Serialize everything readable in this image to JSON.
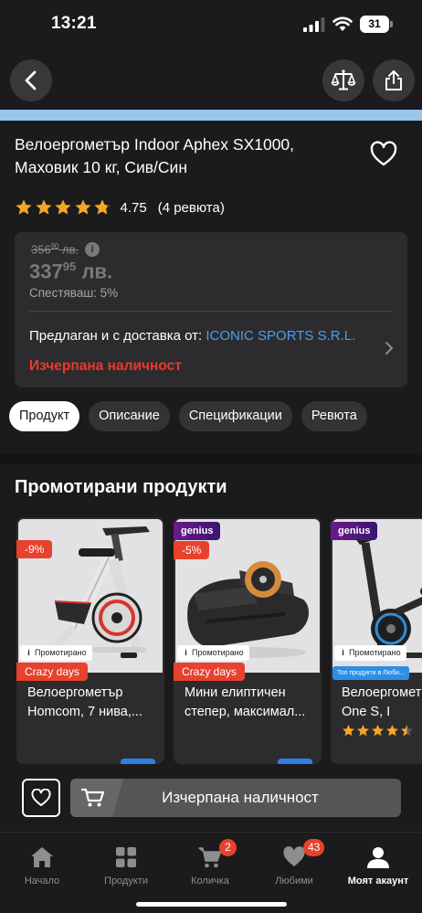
{
  "status_bar": {
    "time": "13:21",
    "battery": "31"
  },
  "product": {
    "title": "Велоергометър Indoor Aphex SX1000, Маховик 10 кг, Сив/Син",
    "rating": "4.75",
    "reviews": "(4 ревюта)",
    "stars_filled": 4.75
  },
  "price": {
    "old_main": "356",
    "old_cents": "90",
    "old_currency": " лв.",
    "current_main": "337",
    "current_cents": "95",
    "current_currency": " лв.",
    "savings": "Спестяваш: 5%",
    "info_icon": "i"
  },
  "seller": {
    "prefix": "Предлаган и с доставка от: ",
    "name": "ICONIC SPORTS S.R.L.",
    "stock_status": "Изчерпана наличност"
  },
  "tabs": [
    {
      "label": "Продукт"
    },
    {
      "label": "Описание"
    },
    {
      "label": "Спецификации"
    },
    {
      "label": "Ревюта"
    }
  ],
  "promoted": {
    "title": "Промотирани продукти",
    "items": [
      {
        "discount": "-9%",
        "promo_badge": "Промотирано",
        "promo_i": "i",
        "tag": "Crazy days",
        "name": "Велоергометър Homcom, 7 нива,..."
      },
      {
        "genius": "genius",
        "discount": "-5%",
        "promo_badge": "Промотирано",
        "promo_i": "i",
        "tag": "Crazy days",
        "name": "Мини елиптичен степер, максимал..."
      },
      {
        "genius": "genius",
        "promo_badge": "Промотирано",
        "promo_i": "i",
        "tag": "Топ продукти в Люби...",
        "name": "Велоергомет Zipro One S, I",
        "stars_filled": 4.5
      }
    ]
  },
  "bottom_action": {
    "label": "Изчерпана наличност"
  },
  "tabbar": {
    "items": [
      {
        "label": "Начало",
        "icon": "home-icon"
      },
      {
        "label": "Продукти",
        "icon": "grid-icon"
      },
      {
        "label": "Количка",
        "icon": "cart-icon",
        "badge": "2"
      },
      {
        "label": "Любими",
        "icon": "heart-icon",
        "badge": "43"
      },
      {
        "label": "Моят акаунт",
        "icon": "person-icon",
        "active": true
      }
    ]
  },
  "colors": {
    "accent_link": "#4a9ff0",
    "alert_red": "#f0362a",
    "star": "#f5a623",
    "badge_red": "#e8412c"
  }
}
